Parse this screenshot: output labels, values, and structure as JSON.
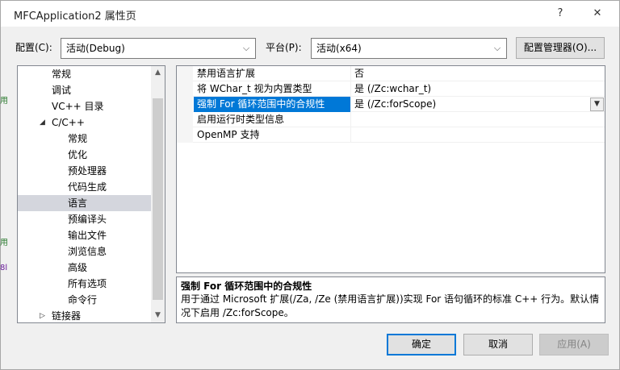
{
  "window": {
    "title": "MFCApplication2 属性页",
    "help": "?",
    "close": "✕"
  },
  "config": {
    "label": "配置(C):",
    "value": "活动(Debug)",
    "platform_label": "平台(P):",
    "platform_value": "活动(x64)",
    "manager_button": "配置管理器(O)..."
  },
  "tree": {
    "items": [
      {
        "label": "常规"
      },
      {
        "label": "调试"
      },
      {
        "label": "VC++ 目录"
      },
      {
        "label": "C/C++"
      },
      {
        "label": "常规"
      },
      {
        "label": "优化"
      },
      {
        "label": "预处理器"
      },
      {
        "label": "代码生成"
      },
      {
        "label": "语言"
      },
      {
        "label": "预编译头"
      },
      {
        "label": "输出文件"
      },
      {
        "label": "浏览信息"
      },
      {
        "label": "高级"
      },
      {
        "label": "所有选项"
      },
      {
        "label": "命令行"
      },
      {
        "label": "链接器"
      }
    ],
    "expanded_glyph": "◢",
    "collapsed_glyph": "▷"
  },
  "grid": {
    "rows": [
      {
        "name": "禁用语言扩展",
        "value": "否"
      },
      {
        "name": "将 WChar_t 视为内置类型",
        "value": "是 (/Zc:wchar_t)"
      },
      {
        "name": "强制 For 循环范围中的合规性",
        "value": "是 (/Zc:forScope)"
      },
      {
        "name": "启用运行时类型信息",
        "value": ""
      },
      {
        "name": "OpenMP 支持",
        "value": ""
      }
    ]
  },
  "description": {
    "title": "强制 For 循环范围中的合规性",
    "text_line1": "用于通过 Microsoft 扩展(/Za, /Ze (禁用语言扩展))实现 For 语句循环的标准 C++ 行为。默认情",
    "text_line2": "况下启用 /Zc:forScope。"
  },
  "buttons": {
    "ok": "确定",
    "cancel": "取消",
    "apply": "应用(A)"
  },
  "background": {
    "frag1": "用",
    "frag2": "用",
    "frag3": "8l"
  }
}
